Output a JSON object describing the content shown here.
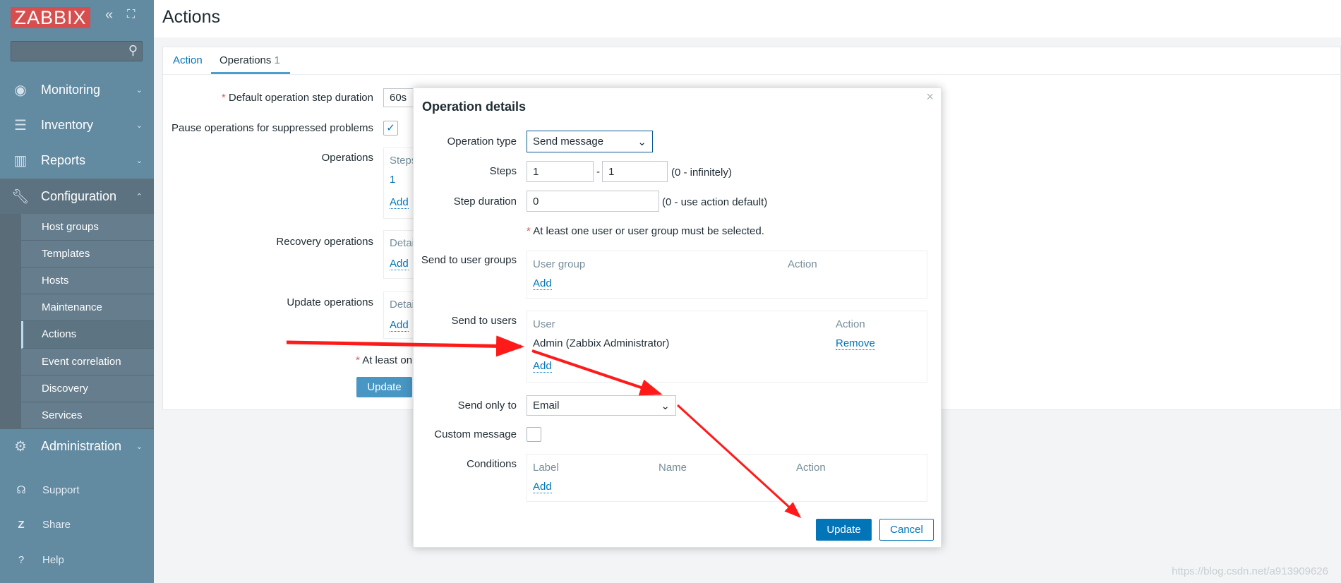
{
  "sidebar": {
    "logo": "ZABBIX",
    "search_placeholder": "",
    "menu": [
      {
        "label": "Monitoring",
        "icon": "eye-icon"
      },
      {
        "label": "Inventory",
        "icon": "list-icon"
      },
      {
        "label": "Reports",
        "icon": "bar-chart-icon"
      },
      {
        "label": "Configuration",
        "icon": "wrench-icon"
      },
      {
        "label": "Administration",
        "icon": "gear-icon"
      }
    ],
    "submenu": [
      "Host groups",
      "Templates",
      "Hosts",
      "Maintenance",
      "Actions",
      "Event correlation",
      "Discovery",
      "Services"
    ],
    "active_submenu": "Actions",
    "footer": [
      {
        "label": "Support",
        "icon": "headset-icon"
      },
      {
        "label": "Share",
        "icon": "share-z-icon"
      },
      {
        "label": "Help",
        "icon": "question-icon"
      }
    ]
  },
  "header": {
    "title": "Actions"
  },
  "tabs": [
    {
      "label": "Action"
    },
    {
      "label": "Operations",
      "count": "1",
      "active": true
    }
  ],
  "form": {
    "default_step_label": "Default operation step duration",
    "default_step_value": "60s",
    "pause_label": "Pause operations for suppressed problems",
    "pause_checked": true,
    "operations_label": "Operations",
    "operations_header": "Steps",
    "operations_row": "1",
    "recovery_label": "Recovery operations",
    "recovery_header": "Details",
    "update_ops_label": "Update operations",
    "update_ops_header": "Details",
    "add": "Add",
    "note": "At least on",
    "update_button": "Update"
  },
  "dialog": {
    "title": "Operation details",
    "close": "×",
    "operation_type_label": "Operation type",
    "operation_type_value": "Send message",
    "steps_label": "Steps",
    "steps_from": "1",
    "steps_dash": "-",
    "steps_to": "1",
    "steps_hint": "(0 - infinitely)",
    "step_duration_label": "Step duration",
    "step_duration_value": "0",
    "step_duration_hint": "(0 - use action default)",
    "required_note": "At least one user or user group must be selected.",
    "groups_label": "Send to user groups",
    "groups_col1": "User group",
    "groups_col2": "Action",
    "users_label": "Send to users",
    "users_col1": "User",
    "users_col2": "Action",
    "users": [
      {
        "name": "Admin (Zabbix Administrator)",
        "action": "Remove"
      }
    ],
    "send_only_label": "Send only to",
    "send_only_value": "Email",
    "custom_message_label": "Custom message",
    "custom_message_checked": false,
    "conditions_label": "Conditions",
    "conditions_cols": [
      "Label",
      "Name",
      "Action"
    ],
    "add": "Add",
    "update_button": "Update",
    "cancel_button": "Cancel"
  },
  "annotation_color": "#ff1a1a",
  "watermark": "https://blog.csdn.net/a913909626"
}
